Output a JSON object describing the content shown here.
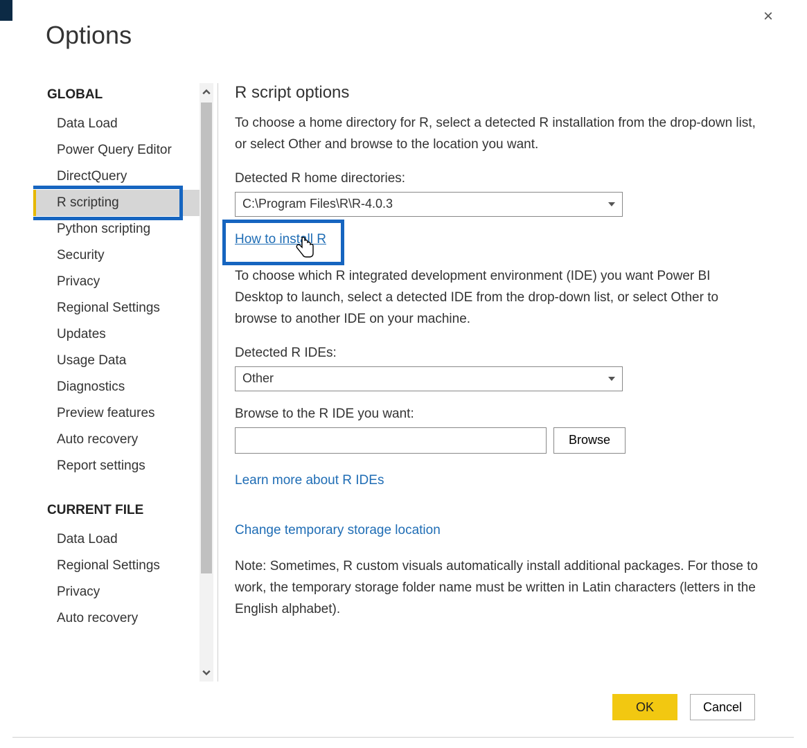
{
  "title": "Options",
  "close_icon": "×",
  "sidebar": {
    "global_header": "GLOBAL",
    "global_items": [
      "Data Load",
      "Power Query Editor",
      "DirectQuery",
      "R scripting",
      "Python scripting",
      "Security",
      "Privacy",
      "Regional Settings",
      "Updates",
      "Usage Data",
      "Diagnostics",
      "Preview features",
      "Auto recovery",
      "Report settings"
    ],
    "selected_index": 3,
    "current_file_header": "CURRENT FILE",
    "current_file_items": [
      "Data Load",
      "Regional Settings",
      "Privacy",
      "Auto recovery"
    ]
  },
  "panel": {
    "heading": "R script options",
    "intro": "To choose a home directory for R, select a detected R installation from the drop-down list, or select Other and browse to the location you want.",
    "home_label": "Detected R home directories:",
    "home_value": "C:\\Program Files\\R\\R-4.0.3",
    "install_link": "How to install R",
    "ide_intro": "To choose which R integrated development environment (IDE) you want Power BI Desktop to launch, select a detected IDE from the drop-down list, or select Other to browse to another IDE on your machine.",
    "ide_label": "Detected R IDEs:",
    "ide_value": "Other",
    "browse_label": "Browse to the R IDE you want:",
    "browse_path": "",
    "browse_btn": "Browse",
    "learn_link": "Learn more about R IDEs",
    "storage_link": "Change temporary storage location",
    "note": "Note: Sometimes, R custom visuals automatically install additional packages. For those to work, the temporary storage folder name must be written in Latin characters (letters in the English alphabet)."
  },
  "buttons": {
    "ok": "OK",
    "cancel": "Cancel"
  }
}
